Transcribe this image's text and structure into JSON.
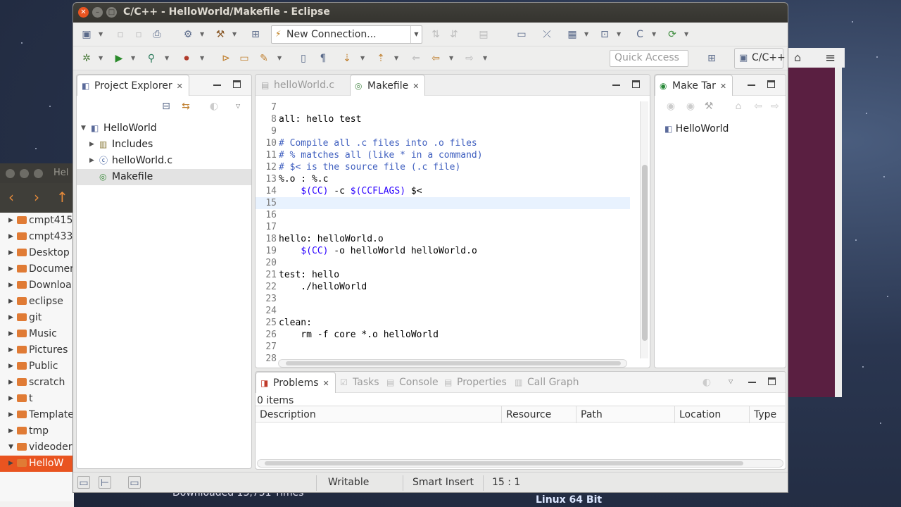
{
  "window": {
    "title": "C/C++ - HelloWorld/Makefile - Eclipse"
  },
  "toolbar": {
    "connection_combo": "New Connection...",
    "quick_access_placeholder": "Quick Access",
    "perspective": "C/C++"
  },
  "project_explorer": {
    "tab_label": "Project Explorer",
    "tree": [
      {
        "label": "HelloWorld",
        "level": 0,
        "expanded": true,
        "icon": "project-icon"
      },
      {
        "label": "Includes",
        "level": 1,
        "expanded": false,
        "icon": "includes-icon"
      },
      {
        "label": "helloWorld.c",
        "level": 1,
        "expanded": false,
        "icon": "c-file-icon"
      },
      {
        "label": "Makefile",
        "level": 1,
        "expanded": null,
        "icon": "makefile-icon",
        "selected": true
      }
    ]
  },
  "editor": {
    "tabs": [
      {
        "label": "helloWorld.c",
        "active": false
      },
      {
        "label": "Makefile",
        "active": true
      }
    ],
    "lines": [
      {
        "n": "7",
        "code": ""
      },
      {
        "n": "8",
        "code": "all: hello test"
      },
      {
        "n": "9",
        "code": ""
      },
      {
        "n": "10",
        "code": "# Compile all .c files into .o files",
        "comment": true
      },
      {
        "n": "11",
        "code": "# % matches all (like * in a command)",
        "comment": true
      },
      {
        "n": "12",
        "code": "# $< is the source file (.c file)",
        "comment": true
      },
      {
        "n": "13",
        "code": "%.o : %.c"
      },
      {
        "n": "14",
        "code": "    $(CC) -c $(CCFLAGS) $<"
      },
      {
        "n": "15",
        "code": "",
        "current": true
      },
      {
        "n": "16",
        "code": ""
      },
      {
        "n": "17",
        "code": ""
      },
      {
        "n": "18",
        "code": "hello: helloWorld.o"
      },
      {
        "n": "19",
        "code": "    $(CC) -o helloWorld helloWorld.o"
      },
      {
        "n": "20",
        "code": ""
      },
      {
        "n": "21",
        "code": "test: hello"
      },
      {
        "n": "22",
        "code": "    ./helloWorld"
      },
      {
        "n": "23",
        "code": ""
      },
      {
        "n": "24",
        "code": ""
      },
      {
        "n": "25",
        "code": "clean:"
      },
      {
        "n": "26",
        "code": "    rm -f core *.o helloWorld"
      },
      {
        "n": "27",
        "code": ""
      },
      {
        "n": "28",
        "code": ""
      }
    ]
  },
  "make_targets": {
    "tab_label": "Make Tar",
    "items": [
      "HelloWorld"
    ]
  },
  "bottom_panel": {
    "tabs": [
      "Problems",
      "Tasks",
      "Console",
      "Properties",
      "Call Graph"
    ],
    "item_count": "0 items",
    "columns": [
      "Description",
      "Resource",
      "Path",
      "Location",
      "Type"
    ]
  },
  "status_bar": {
    "mode": "Writable",
    "insert_mode": "Smart Insert",
    "position": "15 : 1"
  },
  "file_manager": {
    "title": "Hel",
    "items": [
      {
        "label": "cmpt415"
      },
      {
        "label": "cmpt433"
      },
      {
        "label": "Desktop"
      },
      {
        "label": "Documen"
      },
      {
        "label": "Downloa"
      },
      {
        "label": "eclipse"
      },
      {
        "label": "git"
      },
      {
        "label": "Music"
      },
      {
        "label": "Pictures"
      },
      {
        "label": "Public"
      },
      {
        "label": "scratch"
      },
      {
        "label": "t"
      },
      {
        "label": "Template"
      },
      {
        "label": "tmp"
      },
      {
        "label": "videoder"
      },
      {
        "label": "HelloW",
        "selected": true
      }
    ]
  },
  "desktop": {
    "downloaded_text": "Downloaded 13,751 Times",
    "linux_label": "Linux 64 Bit"
  }
}
